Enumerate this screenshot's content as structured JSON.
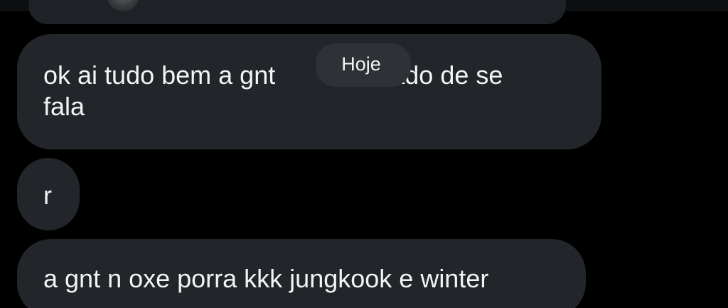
{
  "messages": [
    {
      "text": "ok ai tudo bem a gnt             arado de se\nfala"
    },
    {
      "text": "r"
    },
    {
      "text": "a gnt n oxe porra kkk jungkook e winter"
    }
  ],
  "date_separator": {
    "label": "Hoje"
  },
  "colors": {
    "background": "#000000",
    "bubble": "#222529",
    "date_pill": "#2e3236",
    "text": "#f2f3f5"
  }
}
